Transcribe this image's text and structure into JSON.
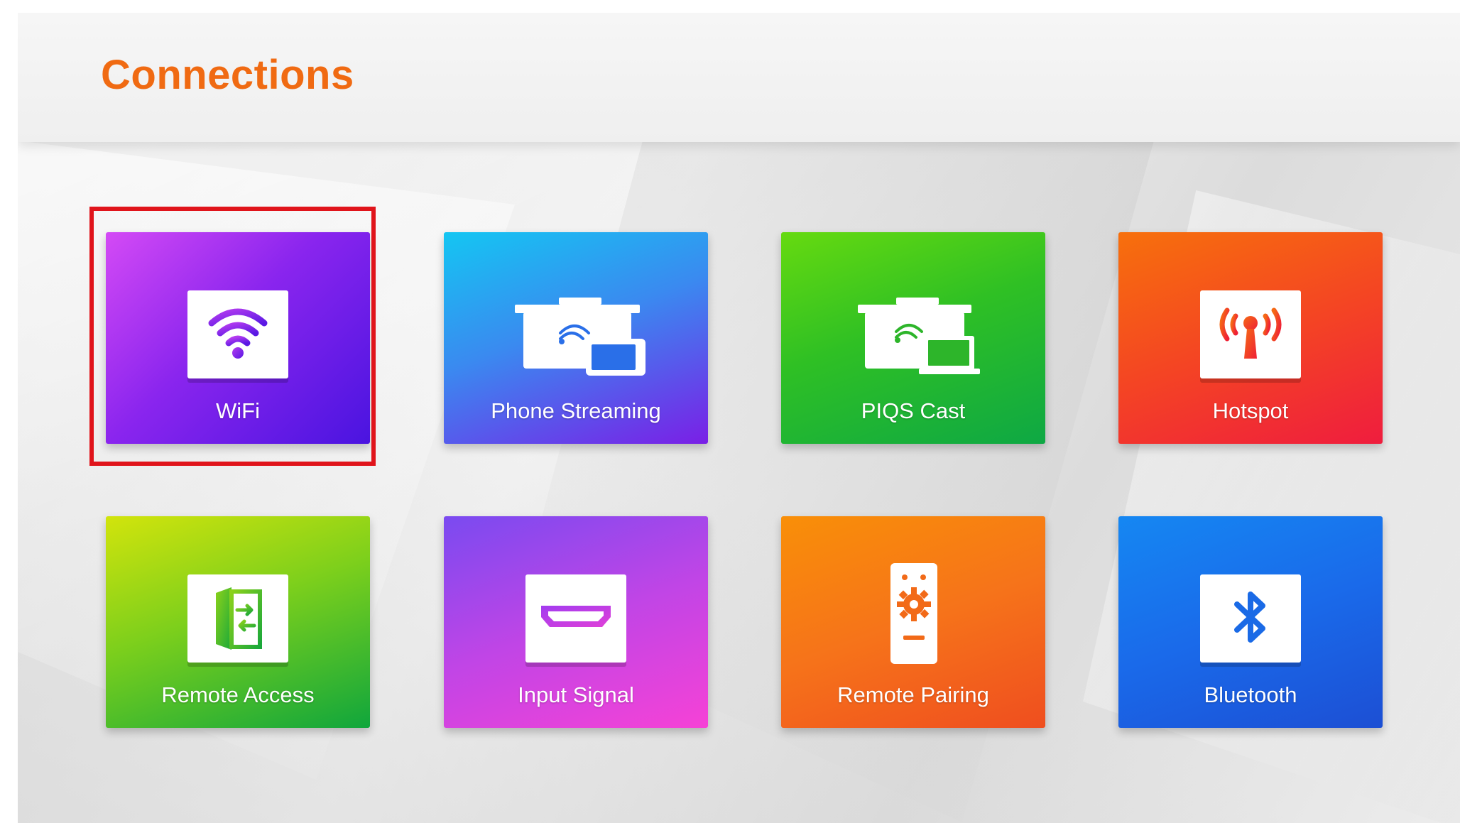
{
  "header": {
    "title": "Connections"
  },
  "tiles": [
    {
      "label": "WiFi",
      "icon": "wifi-icon"
    },
    {
      "label": "Phone Streaming",
      "icon": "phone-streaming-icon"
    },
    {
      "label": "PIQS Cast",
      "icon": "laptop-cast-icon"
    },
    {
      "label": "Hotspot",
      "icon": "hotspot-antenna-icon"
    },
    {
      "label": "Remote Access",
      "icon": "door-arrows-icon"
    },
    {
      "label": "Input Signal",
      "icon": "hdmi-port-icon"
    },
    {
      "label": "Remote Pairing",
      "icon": "remote-control-icon"
    },
    {
      "label": "Bluetooth",
      "icon": "bluetooth-icon"
    }
  ],
  "selected_tile": "WiFi",
  "colors": {
    "title": "#f06a12",
    "focus_ring": "#e0141b",
    "wifi_tile": [
      "#c43cf2",
      "#5b16e6"
    ],
    "phone_streaming_tile": [
      "#19c7f0",
      "#7a20e8"
    ],
    "piqs_cast_tile": [
      "#58d612",
      "#0fa83e"
    ],
    "hotspot_tile": [
      "#f7650f",
      "#f01e3c"
    ],
    "remote_access_tile": [
      "#c8e40d",
      "#11a83a"
    ],
    "input_signal_tile": [
      "#9a3af0",
      "#f040d8"
    ],
    "remote_pairing_tile": [
      "#f78c0a",
      "#f0551a"
    ],
    "bluetooth_tile": [
      "#1380f0",
      "#1a4fd6"
    ]
  }
}
